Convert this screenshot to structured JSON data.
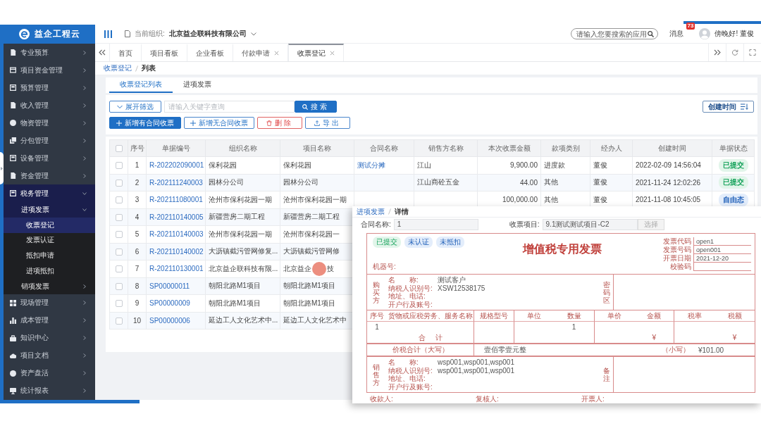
{
  "sidebar": {
    "logo": "益企工程云",
    "items": [
      {
        "label": "专业预算",
        "expanded": false,
        "selected": false
      },
      {
        "label": "项目资金管理",
        "expanded": false,
        "selected": false
      },
      {
        "label": "预算管理",
        "expanded": false,
        "selected": false
      },
      {
        "label": "收入管理",
        "expanded": false,
        "selected": false
      },
      {
        "label": "物资管理",
        "expanded": false,
        "selected": false
      },
      {
        "label": "分包管理",
        "expanded": false,
        "selected": false
      },
      {
        "label": "设备管理",
        "expanded": false,
        "selected": false
      },
      {
        "label": "资金管理",
        "expanded": false,
        "selected": false
      },
      {
        "label": "税务管理",
        "expanded": true,
        "selected": false,
        "children": [
          {
            "label": "进项发票",
            "expanded": true,
            "selected": false,
            "children": [
              {
                "label": "收票登记",
                "selected": true
              },
              {
                "label": "发票认证",
                "selected": false
              },
              {
                "label": "抵扣申请",
                "selected": false
              },
              {
                "label": "进项抵扣",
                "selected": false
              }
            ]
          },
          {
            "label": "销项发票",
            "expanded": false,
            "selected": false
          }
        ]
      },
      {
        "label": "现场管理",
        "expanded": false,
        "selected": false
      },
      {
        "label": "成本管理",
        "expanded": false,
        "selected": false
      },
      {
        "label": "知识中心",
        "expanded": false,
        "selected": false
      },
      {
        "label": "项目文档",
        "expanded": false,
        "selected": false
      },
      {
        "label": "资产盘活",
        "expanded": false,
        "selected": false
      },
      {
        "label": "统计报表",
        "expanded": false,
        "selected": false
      }
    ]
  },
  "topbar": {
    "org_label": "当前组织:",
    "org_name": "北京益企联科技有限公司",
    "search": {
      "placeholder": "请输入您要搜索的应用"
    },
    "messages": {
      "label": "消息",
      "badge": "73"
    },
    "greeting": "傍晚好! 董俊"
  },
  "tabs": [
    {
      "label": "首页",
      "closable": false,
      "selected": false
    },
    {
      "label": "项目看板",
      "closable": false,
      "selected": false
    },
    {
      "label": "企业看板",
      "closable": false,
      "selected": false
    },
    {
      "label": "付款申请",
      "closable": true,
      "selected": false
    },
    {
      "label": "收票登记",
      "closable": true,
      "selected": true
    }
  ],
  "breadcrumb": [
    "收票登记",
    "列表"
  ],
  "sub_tabs": [
    {
      "label": "收票登记列表",
      "selected": true
    },
    {
      "label": "进项发票",
      "selected": false
    }
  ],
  "toolbar": {
    "filter_toggle": "展开筛选",
    "search": {
      "placeholder": "请输入关键字查询"
    },
    "search_button": "搜索",
    "sort_button": "创建时间",
    "actions": [
      {
        "label": "新增有合同收票",
        "kind": "primary"
      },
      {
        "label": "新增无合同收票",
        "kind": "secondary"
      },
      {
        "label": "删除",
        "kind": "danger"
      },
      {
        "label": "导出",
        "kind": "export"
      }
    ]
  },
  "table": {
    "select_all_checked": false,
    "columns": [
      "序号",
      "单据编号",
      "组织名称",
      "项目名称",
      "合同名称",
      "销售方名称",
      "本次收票金额",
      "款项类别",
      "经办人",
      "创建时间",
      "单据状态"
    ],
    "rows": [
      {
        "checked": false,
        "index": "1",
        "code": "R-202202090001",
        "org": "保利花园",
        "project": "保利花园",
        "contract": "测试分摊",
        "seller": "江山",
        "amount": "9,900.00",
        "category": "进度款",
        "handler": "董俊",
        "created": "2022-02-09 14:56:04",
        "status": {
          "label": "已提交",
          "kind": "submitted"
        }
      },
      {
        "checked": false,
        "index": "2",
        "code": "R-202111240003",
        "org": "园林分公司",
        "project": "园林分公司",
        "seller": "江山商砼五金",
        "amount": "44.00",
        "category": "其他",
        "handler": "董俊",
        "created": "2021-11-24 12:02:26",
        "status": {
          "label": "已提交",
          "kind": "submitted"
        }
      },
      {
        "checked": false,
        "index": "3",
        "code": "R-202111080001",
        "org": "沧州市保利花园一期",
        "project": "沧州市保利花园一期",
        "amount": "100,000.00",
        "category": "其他",
        "handler": "董俊",
        "created": "2021-11-08 10:45:05",
        "status": {
          "label": "自由态",
          "kind": "draft"
        }
      },
      {
        "checked": false,
        "index": "4",
        "code": "R-202110140005",
        "org": "新疆营房二期工程",
        "project": "新疆营房二期工程"
      },
      {
        "checked": false,
        "index": "5",
        "code": "R-202110140003",
        "org": "沧州市保利花园一期",
        "project": "沧州市保利花园一"
      },
      {
        "checked": false,
        "index": "6",
        "code": "R-202110140002",
        "org": "大沥镇截污管网修复...",
        "project": "大沥镇截污管网修"
      },
      {
        "checked": false,
        "index": "7",
        "code": "R-202110130001",
        "org": "北京益企联科技有限...",
        "project": "北京益企",
        "click_marker": true,
        "project_tail": "技"
      },
      {
        "checked": false,
        "index": "8",
        "code": "SP00000011",
        "org": "朝阳北路M1项目",
        "project": "朝阳北路M1项目"
      },
      {
        "checked": false,
        "index": "9",
        "code": "SP00000009",
        "org": "朝阳北路M1项目",
        "project": "朝阳北路M1项目"
      },
      {
        "checked": false,
        "index": "10",
        "code": "SP00000006",
        "org": "延边工人文化艺术中...",
        "project": "延边工人文化艺术中"
      }
    ]
  },
  "detail_panel": {
    "breadcrumb": [
      "进项发票",
      "详情"
    ],
    "fields": [
      {
        "label": "合同名称:",
        "value": "1"
      },
      {
        "label": "收票项目:",
        "value": "9.1测试测试项目-C2",
        "button": {
          "label": "选择",
          "disabled": true
        }
      }
    ],
    "invoice": {
      "tags": [
        {
          "label": "已提交",
          "kind": "submitted"
        },
        {
          "label": "未认证",
          "kind": "info"
        },
        {
          "label": "未抵扣",
          "kind": "info"
        }
      ],
      "title": "增值税专用发票",
      "meta": [
        {
          "label": "发票代码",
          "value": "open1"
        },
        {
          "label": "发票号码",
          "value": "open001"
        },
        {
          "label": "开票日期",
          "value": "2021-12-20"
        },
        {
          "label": "校验码"
        }
      ],
      "machine_label": "机器号:",
      "buyer": {
        "heading": "购买方",
        "side_heading": "密码区",
        "lines": [
          {
            "label": "名　　称:",
            "value": "测试客户"
          },
          {
            "label": "纳税人识别号:",
            "value": "XSW12538175"
          },
          {
            "label": "地址、电话:"
          },
          {
            "label": "开户行及账号:"
          }
        ]
      },
      "item_columns": [
        "序号",
        "货物或应税劳务、服务名称",
        "规格型号",
        "单位",
        "数量",
        "单价",
        "金额",
        "税率",
        "税额"
      ],
      "item_rows": [
        {
          "index": "1",
          "quantity": "1"
        }
      ],
      "total": {
        "label": "合计",
        "amount": "¥",
        "tax": "¥"
      },
      "grand_total": {
        "label": "价税合计（大写）",
        "words": "壹佰零壹元整",
        "small_label": "（小写）",
        "amount": "¥101.00"
      },
      "seller": {
        "heading": "销售方",
        "side_heading": "备注",
        "lines": [
          {
            "label": "名　　称:",
            "value": "wsp001,wsp001,wsp001"
          },
          {
            "label": "纳税人识别号:",
            "value": "wsp001,wsp001,wsp001"
          },
          {
            "label": "地址、电话:"
          },
          {
            "label": "开户行及账号:"
          }
        ]
      },
      "signatures": [
        "收款人:",
        "复核人:",
        "开票人:"
      ]
    }
  }
}
